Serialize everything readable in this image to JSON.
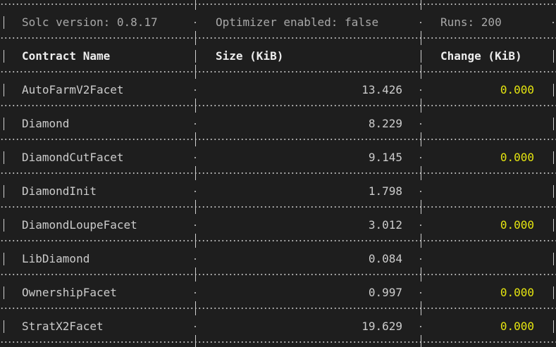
{
  "meta": {
    "solc_version": "Solc version: 0.8.17",
    "optimizer": "Optimizer enabled: false",
    "runs": "Runs: 200"
  },
  "headers": {
    "name": "Contract Name",
    "size": "Size (KiB)",
    "change": "Change (KiB)"
  },
  "rows": [
    {
      "name": "AutoFarmV2Facet",
      "size": "13.426",
      "change": "0.000"
    },
    {
      "name": "Diamond",
      "size": "8.229",
      "change": ""
    },
    {
      "name": "DiamondCutFacet",
      "size": "9.145",
      "change": "0.000"
    },
    {
      "name": "DiamondInit",
      "size": "1.798",
      "change": ""
    },
    {
      "name": "DiamondLoupeFacet",
      "size": "3.012",
      "change": "0.000"
    },
    {
      "name": "LibDiamond",
      "size": "0.084",
      "change": ""
    },
    {
      "name": "OwnershipFacet",
      "size": "0.997",
      "change": "0.000"
    },
    {
      "name": "StratX2Facet",
      "size": "19.629",
      "change": "0.000"
    }
  ],
  "colors": {
    "background": "#1e1e1e",
    "text": "#cccccc",
    "muted": "#a8a8a8",
    "change_highlight": "#e5e510"
  }
}
